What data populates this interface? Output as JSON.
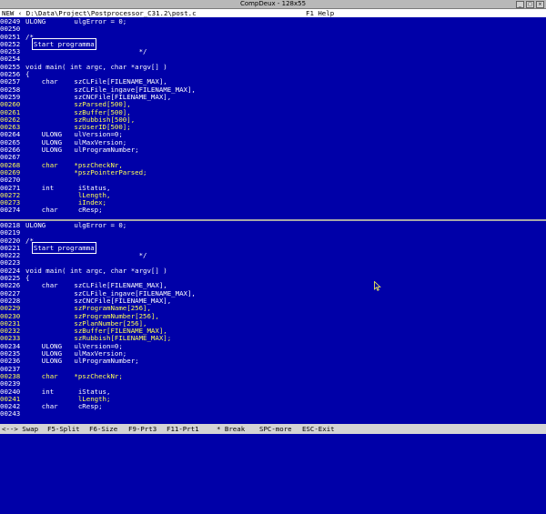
{
  "window": {
    "title": "CompDeux - 128x55",
    "buttons": [
      "_",
      "□",
      "×"
    ]
  },
  "menubar": {
    "path": "NEW ‹ D:\\Data\\Project\\Postprocessor_C31.2\\post.c",
    "help": "F1 Help"
  },
  "top_pane": [
    {
      "n": "00249",
      "t": "ULONG       ulgError = 0;",
      "h": false
    },
    {
      "n": "00250",
      "t": "",
      "h": false
    },
    {
      "n": "00251",
      "t": "/*",
      "h": false
    },
    {
      "n": "00252",
      "t": "",
      "box": "Start programma",
      "h": false
    },
    {
      "n": "00253",
      "t": "                            */",
      "h": false
    },
    {
      "n": "00254",
      "t": "",
      "h": false
    },
    {
      "n": "00255",
      "t": "void main( int argc, char *argv[] )",
      "h": false
    },
    {
      "n": "00256",
      "t": "{",
      "h": false
    },
    {
      "n": "00257",
      "t": "    char    szCLFile[FILENAME_MAX],",
      "h": false
    },
    {
      "n": "00258",
      "t": "            szCLFile_ingave[FILENAME_MAX],",
      "h": false
    },
    {
      "n": "00259",
      "t": "            szCNCFile[FILENAME_MAX],",
      "h": false
    },
    {
      "n": "00260",
      "t": "            szParsed[500],",
      "h": true
    },
    {
      "n": "00261",
      "t": "            szBuffer[500],",
      "h": true
    },
    {
      "n": "00262",
      "t": "            szRubbish[500],",
      "h": true
    },
    {
      "n": "00263",
      "t": "            szUserID[500];",
      "h": true
    },
    {
      "n": "00264",
      "t": "    ULONG   ulVersion=0;",
      "h": false
    },
    {
      "n": "00265",
      "t": "    ULONG   ulMaxVersion;",
      "h": false
    },
    {
      "n": "00266",
      "t": "    ULONG   ulProgramNumber;",
      "h": false
    },
    {
      "n": "00267",
      "t": "",
      "h": false
    },
    {
      "n": "00268",
      "t": "    char    *pszCheckNr,",
      "h": true
    },
    {
      "n": "00269",
      "t": "            *pszPointerParsed;",
      "h": true
    },
    {
      "n": "00270",
      "t": "",
      "h": false
    },
    {
      "n": "00271",
      "t": "    int      iStatus,",
      "h": false
    },
    {
      "n": "00272",
      "t": "             lLength,",
      "h": true
    },
    {
      "n": "00273",
      "t": "             iIndex;",
      "h": true
    },
    {
      "n": "00274",
      "t": "    char     cResp;",
      "h": false
    }
  ],
  "bottom_pane": [
    {
      "n": "00218",
      "t": "ULONG       ulgError = 0;",
      "h": false
    },
    {
      "n": "00219",
      "t": "",
      "h": false
    },
    {
      "n": "00220",
      "t": "/*",
      "h": false
    },
    {
      "n": "00221",
      "t": "",
      "box": "Start programma",
      "h": false
    },
    {
      "n": "00222",
      "t": "                            */",
      "h": false
    },
    {
      "n": "00223",
      "t": "",
      "h": false
    },
    {
      "n": "00224",
      "t": "void main( int argc, char *argv[] )",
      "h": false
    },
    {
      "n": "00225",
      "t": "{",
      "h": false
    },
    {
      "n": "00226",
      "t": "    char    szCLFile[FILENAME_MAX],",
      "h": false
    },
    {
      "n": "00227",
      "t": "            szCLFile_ingave[FILENAME_MAX],",
      "h": false
    },
    {
      "n": "00228",
      "t": "            szCNCFile[FILENAME_MAX],",
      "h": false
    },
    {
      "n": "00229",
      "t": "            szProgramName[256],",
      "h": true
    },
    {
      "n": "00230",
      "t": "            szProgramNumber[256],",
      "h": true
    },
    {
      "n": "00231",
      "t": "            szPlanNumber[256],",
      "h": true
    },
    {
      "n": "00232",
      "t": "            szBuffer[FILENAME_MAX],",
      "h": true
    },
    {
      "n": "00233",
      "t": "            szRubbish[FILENAME_MAX];",
      "h": true
    },
    {
      "n": "00234",
      "t": "    ULONG   ulVersion=0;",
      "h": false
    },
    {
      "n": "00235",
      "t": "    ULONG   ulMaxVersion;",
      "h": false
    },
    {
      "n": "00236",
      "t": "    ULONG   ulProgramNumber;",
      "h": false
    },
    {
      "n": "00237",
      "t": "",
      "h": false
    },
    {
      "n": "00238",
      "t": "    char    *pszCheckNr;",
      "h": true
    },
    {
      "n": "00239",
      "t": "",
      "h": false
    },
    {
      "n": "00240",
      "t": "    int      iStatus,",
      "h": false
    },
    {
      "n": "00241",
      "t": "             lLength;",
      "h": true
    },
    {
      "n": "00242",
      "t": "    char     cResp;",
      "h": false
    },
    {
      "n": "00243",
      "t": "",
      "h": false
    }
  ],
  "statusbar": {
    "items": [
      "<--> Swap",
      "F5-Split",
      "F6-Size",
      "F9-Prt3",
      "F11-Prt1",
      "* Break",
      "SPC-more",
      "ESC-Exit"
    ]
  },
  "colors": {
    "background": "#0000a8",
    "text": "#ffffff",
    "highlight": "#ffff54",
    "status": "#d4d4d4"
  }
}
